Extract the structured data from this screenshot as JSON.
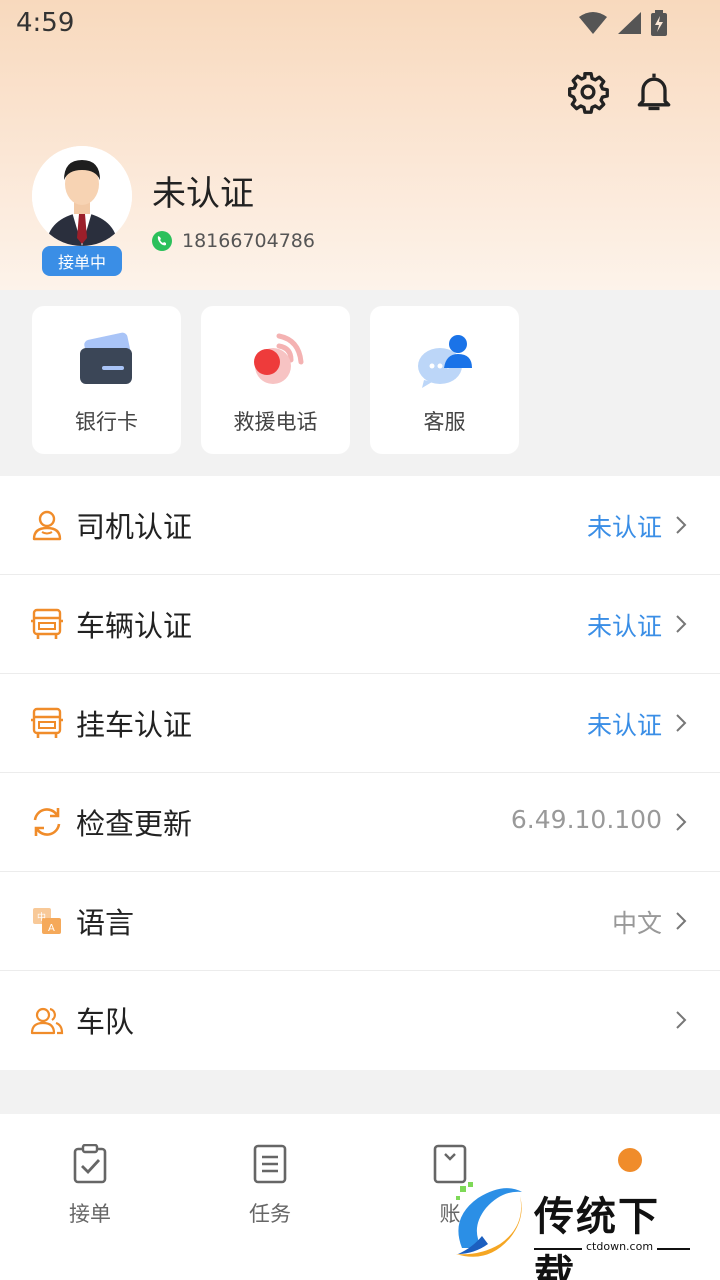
{
  "status_bar": {
    "time": "4:59"
  },
  "profile": {
    "name": "未认证",
    "status_badge": "接单中",
    "phone": "18166704786"
  },
  "quick_actions": [
    {
      "label": "银行卡",
      "icon": "bank-card-icon"
    },
    {
      "label": "救援电话",
      "icon": "rescue-phone-icon"
    },
    {
      "label": "客服",
      "icon": "customer-service-icon"
    }
  ],
  "menu": [
    {
      "label": "司机认证",
      "value": "未认证",
      "icon": "driver-icon"
    },
    {
      "label": "车辆认证",
      "value": "未认证",
      "icon": "vehicle-icon"
    },
    {
      "label": "挂车认证",
      "value": "未认证",
      "icon": "trailer-icon"
    },
    {
      "label": "检查更新",
      "value": "6.49.10.100",
      "icon": "refresh-icon"
    },
    {
      "label": "语言",
      "value": "中文",
      "icon": "language-icon"
    },
    {
      "label": "车队",
      "value": "",
      "icon": "team-icon"
    }
  ],
  "tabs": [
    {
      "label": "接单",
      "icon": "clipboard-check-icon"
    },
    {
      "label": "任务",
      "icon": "task-list-icon"
    },
    {
      "label": "账",
      "icon": "bill-icon"
    }
  ],
  "watermark": {
    "title": "传统下载",
    "domain": "ctdown.com"
  },
  "colors": {
    "accent": "#f08c2a",
    "link": "#3a8ee6",
    "header_top": "#f8d9bd"
  }
}
